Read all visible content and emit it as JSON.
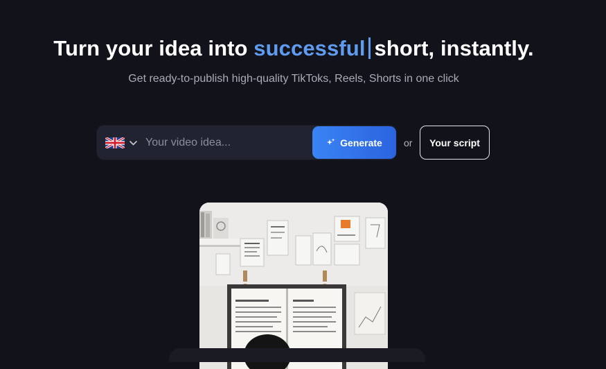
{
  "hero": {
    "title_part1": "Turn your idea into ",
    "title_accent": "successful",
    "title_part2": "short, instantly.",
    "subtitle": "Get ready-to-publish high-quality TikToks, Reels, Shorts in one click",
    "accent_color": "#5f9cf0"
  },
  "search": {
    "language_icon": "uk-flag-icon",
    "placeholder": "Your video idea...",
    "value": "",
    "generate_label": "Generate",
    "generate_icon": "sparkle-icon",
    "button_color": "#2f6fe6"
  },
  "separator": "or",
  "script_button": {
    "label": "Your script"
  },
  "preview": {
    "image": "video-preview-workspace"
  }
}
